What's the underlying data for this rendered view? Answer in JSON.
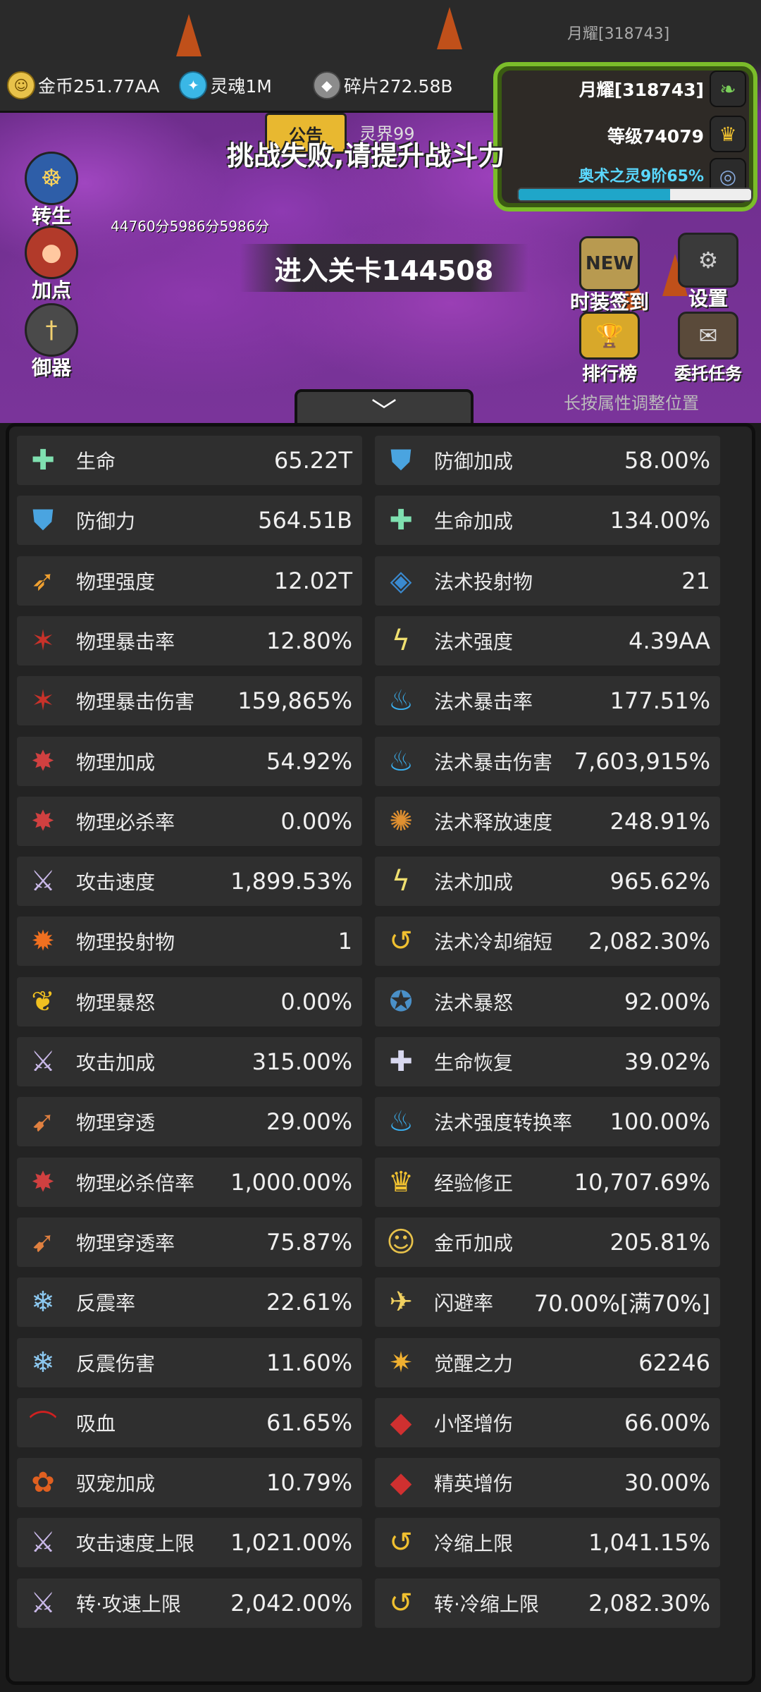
{
  "header": {
    "top_name": "月耀[318743]",
    "resources": [
      {
        "icon": "gold-coin-icon",
        "label": "金币251.77AA"
      },
      {
        "icon": "soul-icon",
        "label": "灵魂1M"
      },
      {
        "icon": "fragment-icon",
        "label": "碎片272.58B"
      }
    ]
  },
  "player": {
    "name": "月耀[318743]",
    "level": "等级74079",
    "arcane": "奥术之灵9阶65%",
    "arcane_progress": 0.65
  },
  "scene": {
    "notice": "公告",
    "realm": "灵界99",
    "fail_message": "挑战失败,请提升战斗力",
    "scores": "44760分5986分5986分",
    "enter_stage": "进入关卡144508",
    "hint": "长按属性调整位置"
  },
  "left_menu": [
    {
      "icon": "rebirth-icon",
      "label": "转生"
    },
    {
      "icon": "meat-icon",
      "label": "加点"
    },
    {
      "icon": "sword-icon",
      "label": "御器"
    }
  ],
  "right_menu": [
    {
      "icon": "new-badge-icon",
      "label": "时装签到",
      "badge": "NEW"
    },
    {
      "icon": "gear-icon",
      "label": "设置"
    },
    {
      "icon": "trophy-icon",
      "label": "排行榜"
    },
    {
      "icon": "scroll-icon",
      "label": "委托任务"
    }
  ],
  "stats_left": [
    {
      "icon": "life-cross-icon",
      "name": "生命",
      "value": "65.22T"
    },
    {
      "icon": "shield-icon",
      "name": "防御力",
      "value": "564.51B"
    },
    {
      "icon": "physical-strength-icon",
      "name": "物理强度",
      "value": "12.02T"
    },
    {
      "icon": "physical-crit-icon",
      "name": "物理暴击率",
      "value": "12.80%"
    },
    {
      "icon": "physical-crit-icon",
      "name": "物理暴击伤害",
      "value": "159,865%"
    },
    {
      "icon": "physical-bonus-icon",
      "name": "物理加成",
      "value": "54.92%"
    },
    {
      "icon": "physical-bonus-icon",
      "name": "物理必杀率",
      "value": "0.00%"
    },
    {
      "icon": "attack-speed-icon",
      "name": "攻击速度",
      "value": "1,899.53%"
    },
    {
      "icon": "projectile-icon",
      "name": "物理投射物",
      "value": "1"
    },
    {
      "icon": "rage-icon",
      "name": "物理暴怒",
      "value": "0.00%"
    },
    {
      "icon": "sword-icon",
      "name": "攻击加成",
      "value": "315.00%"
    },
    {
      "icon": "pierce-icon",
      "name": "物理穿透",
      "value": "29.00%"
    },
    {
      "icon": "physical-bonus-icon",
      "name": "物理必杀倍率",
      "value": "1,000.00%"
    },
    {
      "icon": "pierce-icon",
      "name": "物理穿透率",
      "value": "75.87%"
    },
    {
      "icon": "snowflake-icon",
      "name": "反震率",
      "value": "22.61%"
    },
    {
      "icon": "snowflake-icon",
      "name": "反震伤害",
      "value": "11.60%"
    },
    {
      "icon": "bat-icon",
      "name": "吸血",
      "value": "61.65%"
    },
    {
      "icon": "pet-icon",
      "name": "驭宠加成",
      "value": "10.79%"
    },
    {
      "icon": "attack-speed-icon",
      "name": "攻击速度上限",
      "value": "1,021.00%"
    },
    {
      "icon": "attack-speed-icon",
      "name": "转·攻速上限",
      "value": "2,042.00%"
    }
  ],
  "stats_right": [
    {
      "icon": "shield-icon",
      "name": "防御加成",
      "value": "58.00%"
    },
    {
      "icon": "life-cross-icon",
      "name": "生命加成",
      "value": "134.00%"
    },
    {
      "icon": "magic-projectile-icon",
      "name": "法术投射物",
      "value": "21"
    },
    {
      "icon": "lightning-icon",
      "name": "法术强度",
      "value": "4.39AA"
    },
    {
      "icon": "blue-flame-icon",
      "name": "法术暴击率",
      "value": "177.51%"
    },
    {
      "icon": "blue-flame-icon",
      "name": "法术暴击伤害",
      "value": "7,603,915%"
    },
    {
      "icon": "cast-speed-icon",
      "name": "法术释放速度",
      "value": "248.91%"
    },
    {
      "icon": "lightning-icon",
      "name": "法术加成",
      "value": "965.62%"
    },
    {
      "icon": "cooldown-icon",
      "name": "法术冷却缩短",
      "value": "2,082.30%"
    },
    {
      "icon": "magic-rage-icon",
      "name": "法术暴怒",
      "value": "92.00%"
    },
    {
      "icon": "regen-icon",
      "name": "生命恢复",
      "value": "39.02%"
    },
    {
      "icon": "blue-flame-icon",
      "name": "法术强度转换率",
      "value": "100.00%"
    },
    {
      "icon": "crown-icon",
      "name": "经验修正",
      "value": "10,707.69%"
    },
    {
      "icon": "gold-coin-icon",
      "name": "金币加成",
      "value": "205.81%"
    },
    {
      "icon": "boot-icon",
      "name": "闪避率",
      "value": "70.00%[满70%]"
    },
    {
      "icon": "awaken-icon",
      "name": "觉醒之力",
      "value": "62246"
    },
    {
      "icon": "monster-damage-icon",
      "name": "小怪增伤",
      "value": "66.00%"
    },
    {
      "icon": "monster-damage-icon",
      "name": "精英增伤",
      "value": "30.00%"
    },
    {
      "icon": "cooldown-icon",
      "name": "冷缩上限",
      "value": "1,041.15%"
    },
    {
      "icon": "cooldown-icon",
      "name": "转·冷缩上限",
      "value": "2,082.30%"
    }
  ]
}
